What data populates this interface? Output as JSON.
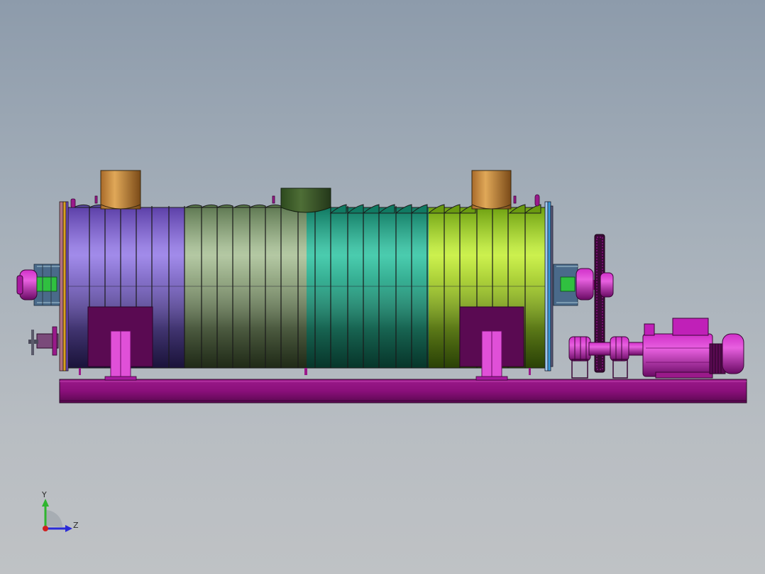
{
  "triad": {
    "y_label": "Y",
    "z_label": "Z",
    "y_color": "#2fb52f",
    "z_color": "#2a2ad8",
    "x_color": "#d02020"
  },
  "colors": {
    "base_frame": "#8a0f7a",
    "drum_section_1": "#7a5ad0",
    "drum_section_2": "#8aa678",
    "drum_section_3": "#1fa88a",
    "drum_section_4": "#9fd81a",
    "nozzle": "#c88a3c",
    "center_port": "#3d5a2a",
    "drive_parts": "#b012a8",
    "support_feet": "#e050d8"
  }
}
